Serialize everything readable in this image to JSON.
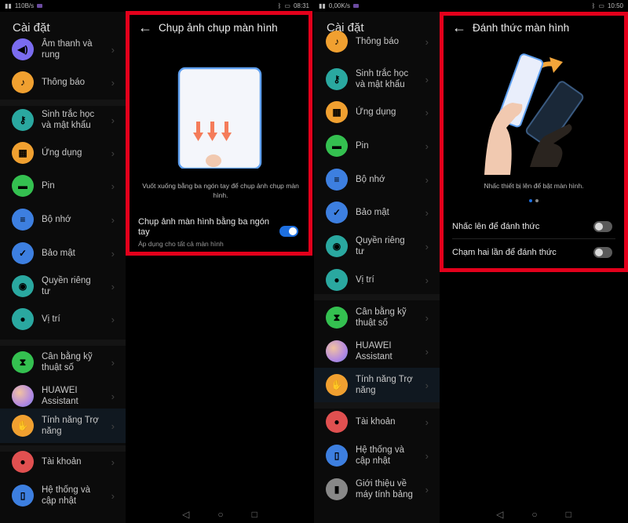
{
  "colors": {
    "frame": "#e3001b",
    "toggle_on": "#1d6fe0",
    "toggle_off": "#5a5a5a",
    "background": "#000000"
  },
  "left": {
    "status": {
      "speed": "110B/s",
      "time": "08:31"
    },
    "settings_title": "Cài đặt",
    "items": [
      {
        "label": "Âm thanh và rung",
        "icon": "volume-icon",
        "color": "#7a6cf0"
      },
      {
        "label": "Thông báo",
        "icon": "bell-icon",
        "color": "#f0a030"
      },
      {
        "label": "Sinh trắc học và mật khẩu",
        "icon": "key-icon",
        "color": "#2aa8a0"
      },
      {
        "label": "Ứng dụng",
        "icon": "apps-icon",
        "color": "#f0a030"
      },
      {
        "label": "Pin",
        "icon": "battery-icon",
        "color": "#34c050"
      },
      {
        "label": "Bộ nhớ",
        "icon": "storage-icon",
        "color": "#3d7fe0"
      },
      {
        "label": "Bảo mật",
        "icon": "shield-icon",
        "color": "#3d7fe0"
      },
      {
        "label": "Quyền riêng tư",
        "icon": "privacy-icon",
        "color": "#2aa8a0"
      },
      {
        "label": "Vị trí",
        "icon": "location-icon",
        "color": "#2aa8a0"
      },
      {
        "label": "Cân bằng kỹ thuật số",
        "icon": "hourglass-icon",
        "color": "#34c050"
      },
      {
        "label": "HUAWEI Assistant",
        "icon": "assistant-icon",
        "color": "#c89ae0"
      },
      {
        "label": "Tính năng Trợ năng",
        "icon": "hand-icon",
        "color": "#f0a030"
      },
      {
        "label": "Tài khoản",
        "icon": "account-icon",
        "color": "#e05050"
      },
      {
        "label": "Hệ thống và cập nhật",
        "icon": "phone-icon",
        "color": "#3d7fe0"
      }
    ],
    "detail": {
      "title": "Chụp ảnh chụp màn hình",
      "description": "Vuốt xuống bằng ba ngón tay để chụp ảnh chụp màn hình.",
      "toggle_label": "Chụp ảnh màn hình bằng ba ngón tay",
      "toggle_sub": "Áp dụng cho tất cả màn hình",
      "toggle_on": true
    }
  },
  "right": {
    "status": {
      "speed": "0,00K/s",
      "time": "10:50"
    },
    "settings_title": "Cài đặt",
    "items": [
      {
        "label": "Thông báo",
        "icon": "bell-icon",
        "color": "#f0a030"
      },
      {
        "label": "Sinh trắc học và mật khẩu",
        "icon": "key-icon",
        "color": "#2aa8a0"
      },
      {
        "label": "Ứng dụng",
        "icon": "apps-icon",
        "color": "#f0a030"
      },
      {
        "label": "Pin",
        "icon": "battery-icon",
        "color": "#34c050"
      },
      {
        "label": "Bộ nhớ",
        "icon": "storage-icon",
        "color": "#3d7fe0"
      },
      {
        "label": "Bảo mật",
        "icon": "shield-icon",
        "color": "#3d7fe0"
      },
      {
        "label": "Quyền riêng tư",
        "icon": "privacy-icon",
        "color": "#2aa8a0"
      },
      {
        "label": "Vị trí",
        "icon": "location-icon",
        "color": "#2aa8a0"
      },
      {
        "label": "Cân bằng kỹ thuật số",
        "icon": "hourglass-icon",
        "color": "#34c050"
      },
      {
        "label": "HUAWEI Assistant",
        "icon": "assistant-icon",
        "color": "#c89ae0"
      },
      {
        "label": "Tính năng Trợ năng",
        "icon": "hand-icon",
        "color": "#f0a030"
      },
      {
        "label": "Tài khoản",
        "icon": "account-icon",
        "color": "#e05050"
      },
      {
        "label": "Hệ thống và cập nhật",
        "icon": "phone-icon",
        "color": "#3d7fe0"
      },
      {
        "label": "Giới thiệu về máy tính bảng",
        "icon": "tablet-icon",
        "color": "#888888"
      }
    ],
    "detail": {
      "title": "Đánh thức màn hình",
      "description": "Nhấc thiết bị lên để bật màn hình.",
      "row1": "Nhấc lên để đánh thức",
      "row2": "Chạm hai lần để đánh thức",
      "row1_on": false,
      "row2_on": false
    }
  },
  "nav": {
    "back": "◁",
    "home": "○",
    "recent": "□"
  }
}
